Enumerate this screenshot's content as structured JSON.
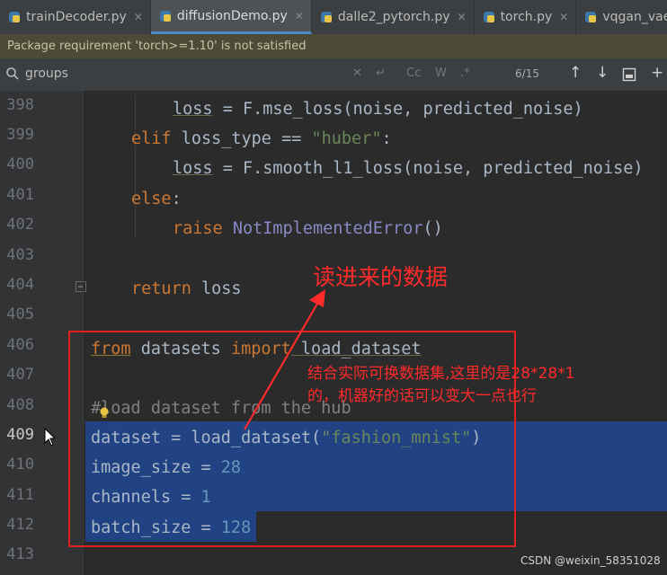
{
  "tabs": [
    {
      "label": "trainDecoder.py",
      "active": false
    },
    {
      "label": "diffusionDemo.py",
      "active": true
    },
    {
      "label": "dalle2_pytorch.py",
      "active": false
    },
    {
      "label": "torch.py",
      "active": false
    },
    {
      "label": "vqgan_vae.py",
      "active": false
    }
  ],
  "notice": "Package requirement 'torch>=1.10' is not satisfied",
  "search": {
    "query": "groups",
    "match_count": "6/15"
  },
  "line_numbers": [
    "398",
    "399",
    "400",
    "401",
    "402",
    "403",
    "404",
    "405",
    "406",
    "407",
    "408",
    "409",
    "410",
    "411",
    "412",
    "413"
  ],
  "current_line": "409",
  "code": {
    "l398": {
      "a": "loss",
      "b": " = F.mse_loss(noise, predicted_noise)"
    },
    "l399": {
      "kw": "elif",
      "b": " loss_type == ",
      "str": "\"huber\"",
      "c": ":"
    },
    "l400": {
      "a": "loss",
      "b": " = F.smooth_l1_loss(noise, predicted_noise)"
    },
    "l401": {
      "kw": "else",
      "c": ":"
    },
    "l402": {
      "kw": "raise",
      "sp": " ",
      "cls": "NotImplementedError",
      "c": "()"
    },
    "l404": {
      "kw": "return",
      "b": " loss"
    },
    "l406": {
      "kw1": "from",
      "b": " datasets ",
      "kw2": "import",
      "c": " load_dataset"
    },
    "l408": {
      "cmt": "#load dataset from the hub"
    },
    "l409": {
      "b": "dataset = load_dataset(",
      "str": "\"fashion_mnist\"",
      "c": ")"
    },
    "l410": {
      "b": "image_size = ",
      "num": "28"
    },
    "l411": {
      "b": "channels = ",
      "num": "1"
    },
    "l412": {
      "b": "batch_size = ",
      "num": "128"
    }
  },
  "annotations": {
    "title": "读进来的数据",
    "note_line1": "结合实际可换数据集,这里的是28*28*1",
    "note_line2": "的，机器好的话可以变大一点也行"
  },
  "watermark": "CSDN @weixin_58351028",
  "colors": {
    "annotation": "#ff2a2a",
    "selection": "#214283",
    "keyword": "#cc7832",
    "string": "#6a8759",
    "number": "#6897bb"
  }
}
